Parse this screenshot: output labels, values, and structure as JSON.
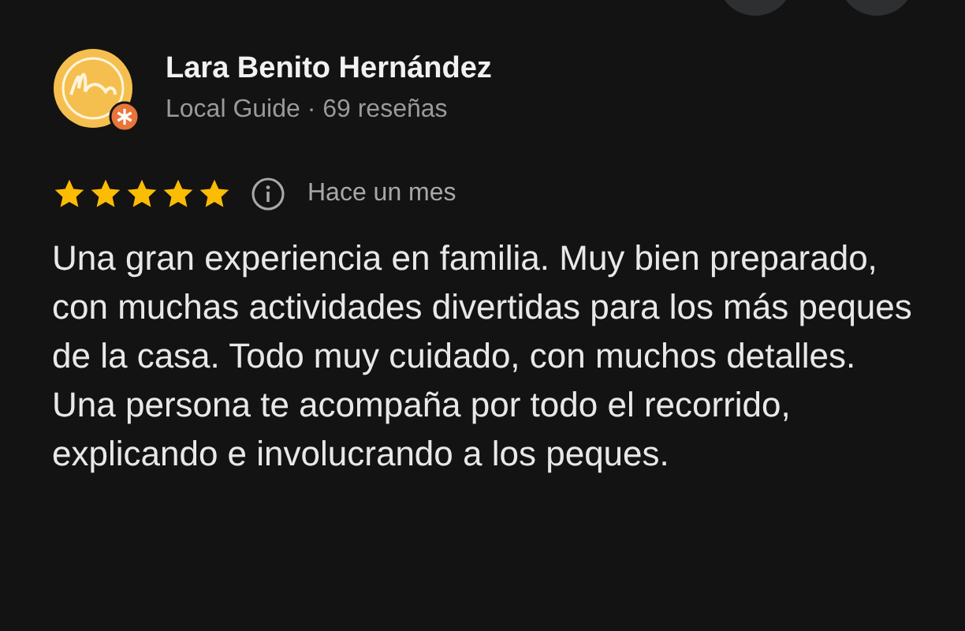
{
  "reviewer": {
    "name": "Lara Benito Hernández",
    "subtitle": "Local Guide · 69 reseñas",
    "local_guide": true
  },
  "review": {
    "stars": 5,
    "time": "Hace un mes",
    "text": "Una gran experiencia en familia. Muy bien preparado, con muchas actividades divertidas para los más peques de la casa. Todo muy cuidado, con muchos detalles. Una persona te acompaña por todo el recorrido, explicando e involucrando a los peques."
  }
}
